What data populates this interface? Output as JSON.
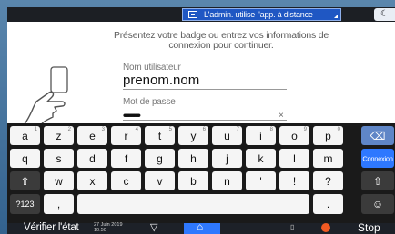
{
  "status_bar": {
    "admin_text": "L'admin. utilise l'app. à distance"
  },
  "login": {
    "instruction_line1": "Présentez votre badge ou entrez vos informations de",
    "instruction_line2": "connexion pour continuer.",
    "username_label": "Nom utilisateur",
    "username_value": "prenom.nom",
    "password_label": "Mot de passe",
    "password_mask": "••••••••••••••",
    "clear_icon": "×"
  },
  "keyboard": {
    "row1": [
      {
        "key": "a",
        "num": "1"
      },
      {
        "key": "z",
        "num": "2"
      },
      {
        "key": "e",
        "num": "3"
      },
      {
        "key": "r",
        "num": "4"
      },
      {
        "key": "t",
        "num": "5"
      },
      {
        "key": "y",
        "num": "6"
      },
      {
        "key": "u",
        "num": "7"
      },
      {
        "key": "i",
        "num": "8"
      },
      {
        "key": "o",
        "num": "9"
      },
      {
        "key": "p",
        "num": "0"
      }
    ],
    "row2": [
      "q",
      "s",
      "d",
      "f",
      "g",
      "h",
      "j",
      "k",
      "l",
      "m"
    ],
    "row3": [
      "w",
      "x",
      "c",
      "v",
      "b",
      "n",
      "'",
      "!",
      "?"
    ],
    "mode_label": "?123",
    "comma_label": ",",
    "period_label": ".",
    "connexion_label": "Connexion",
    "shift_icon": "⇧",
    "backspace_icon": "⌫",
    "emoji_icon": "☺"
  },
  "bottom_bar": {
    "verify_status": "Vérifier l'état",
    "date_line1": "27 Juin 2019",
    "date_line2": "10:50",
    "down_icon": "▽",
    "home_icon": "⌂",
    "stop_label": "Stop"
  },
  "colors": {
    "accent_blue": "#2e78ff",
    "admin_blue": "#1f57c3",
    "stop_orange": "#f15a22"
  }
}
